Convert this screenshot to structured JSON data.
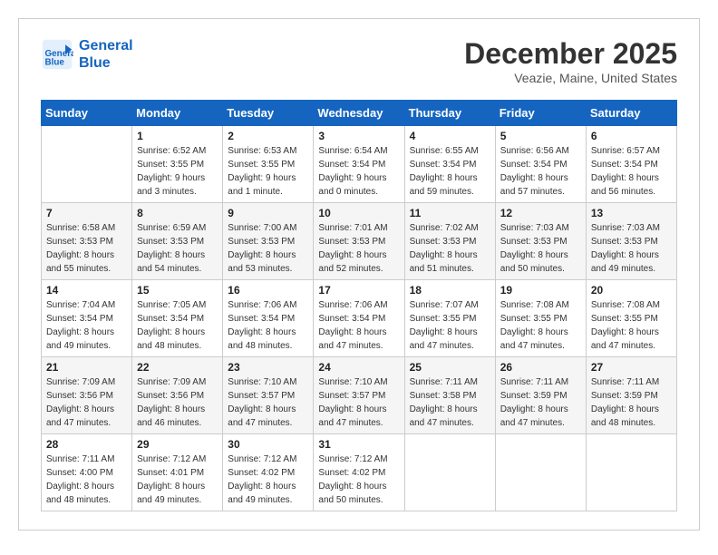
{
  "brand": {
    "line1": "General",
    "line2": "Blue"
  },
  "calendar": {
    "title": "December 2025",
    "subtitle": "Veazie, Maine, United States"
  },
  "headers": [
    "Sunday",
    "Monday",
    "Tuesday",
    "Wednesday",
    "Thursday",
    "Friday",
    "Saturday"
  ],
  "weeks": [
    [
      {
        "day": "",
        "sunrise": "",
        "sunset": "",
        "daylight": ""
      },
      {
        "day": "1",
        "sunrise": "Sunrise: 6:52 AM",
        "sunset": "Sunset: 3:55 PM",
        "daylight": "Daylight: 9 hours and 3 minutes."
      },
      {
        "day": "2",
        "sunrise": "Sunrise: 6:53 AM",
        "sunset": "Sunset: 3:55 PM",
        "daylight": "Daylight: 9 hours and 1 minute."
      },
      {
        "day": "3",
        "sunrise": "Sunrise: 6:54 AM",
        "sunset": "Sunset: 3:54 PM",
        "daylight": "Daylight: 9 hours and 0 minutes."
      },
      {
        "day": "4",
        "sunrise": "Sunrise: 6:55 AM",
        "sunset": "Sunset: 3:54 PM",
        "daylight": "Daylight: 8 hours and 59 minutes."
      },
      {
        "day": "5",
        "sunrise": "Sunrise: 6:56 AM",
        "sunset": "Sunset: 3:54 PM",
        "daylight": "Daylight: 8 hours and 57 minutes."
      },
      {
        "day": "6",
        "sunrise": "Sunrise: 6:57 AM",
        "sunset": "Sunset: 3:54 PM",
        "daylight": "Daylight: 8 hours and 56 minutes."
      }
    ],
    [
      {
        "day": "7",
        "sunrise": "Sunrise: 6:58 AM",
        "sunset": "Sunset: 3:53 PM",
        "daylight": "Daylight: 8 hours and 55 minutes."
      },
      {
        "day": "8",
        "sunrise": "Sunrise: 6:59 AM",
        "sunset": "Sunset: 3:53 PM",
        "daylight": "Daylight: 8 hours and 54 minutes."
      },
      {
        "day": "9",
        "sunrise": "Sunrise: 7:00 AM",
        "sunset": "Sunset: 3:53 PM",
        "daylight": "Daylight: 8 hours and 53 minutes."
      },
      {
        "day": "10",
        "sunrise": "Sunrise: 7:01 AM",
        "sunset": "Sunset: 3:53 PM",
        "daylight": "Daylight: 8 hours and 52 minutes."
      },
      {
        "day": "11",
        "sunrise": "Sunrise: 7:02 AM",
        "sunset": "Sunset: 3:53 PM",
        "daylight": "Daylight: 8 hours and 51 minutes."
      },
      {
        "day": "12",
        "sunrise": "Sunrise: 7:03 AM",
        "sunset": "Sunset: 3:53 PM",
        "daylight": "Daylight: 8 hours and 50 minutes."
      },
      {
        "day": "13",
        "sunrise": "Sunrise: 7:03 AM",
        "sunset": "Sunset: 3:53 PM",
        "daylight": "Daylight: 8 hours and 49 minutes."
      }
    ],
    [
      {
        "day": "14",
        "sunrise": "Sunrise: 7:04 AM",
        "sunset": "Sunset: 3:54 PM",
        "daylight": "Daylight: 8 hours and 49 minutes."
      },
      {
        "day": "15",
        "sunrise": "Sunrise: 7:05 AM",
        "sunset": "Sunset: 3:54 PM",
        "daylight": "Daylight: 8 hours and 48 minutes."
      },
      {
        "day": "16",
        "sunrise": "Sunrise: 7:06 AM",
        "sunset": "Sunset: 3:54 PM",
        "daylight": "Daylight: 8 hours and 48 minutes."
      },
      {
        "day": "17",
        "sunrise": "Sunrise: 7:06 AM",
        "sunset": "Sunset: 3:54 PM",
        "daylight": "Daylight: 8 hours and 47 minutes."
      },
      {
        "day": "18",
        "sunrise": "Sunrise: 7:07 AM",
        "sunset": "Sunset: 3:55 PM",
        "daylight": "Daylight: 8 hours and 47 minutes."
      },
      {
        "day": "19",
        "sunrise": "Sunrise: 7:08 AM",
        "sunset": "Sunset: 3:55 PM",
        "daylight": "Daylight: 8 hours and 47 minutes."
      },
      {
        "day": "20",
        "sunrise": "Sunrise: 7:08 AM",
        "sunset": "Sunset: 3:55 PM",
        "daylight": "Daylight: 8 hours and 47 minutes."
      }
    ],
    [
      {
        "day": "21",
        "sunrise": "Sunrise: 7:09 AM",
        "sunset": "Sunset: 3:56 PM",
        "daylight": "Daylight: 8 hours and 47 minutes."
      },
      {
        "day": "22",
        "sunrise": "Sunrise: 7:09 AM",
        "sunset": "Sunset: 3:56 PM",
        "daylight": "Daylight: 8 hours and 46 minutes."
      },
      {
        "day": "23",
        "sunrise": "Sunrise: 7:10 AM",
        "sunset": "Sunset: 3:57 PM",
        "daylight": "Daylight: 8 hours and 47 minutes."
      },
      {
        "day": "24",
        "sunrise": "Sunrise: 7:10 AM",
        "sunset": "Sunset: 3:57 PM",
        "daylight": "Daylight: 8 hours and 47 minutes."
      },
      {
        "day": "25",
        "sunrise": "Sunrise: 7:11 AM",
        "sunset": "Sunset: 3:58 PM",
        "daylight": "Daylight: 8 hours and 47 minutes."
      },
      {
        "day": "26",
        "sunrise": "Sunrise: 7:11 AM",
        "sunset": "Sunset: 3:59 PM",
        "daylight": "Daylight: 8 hours and 47 minutes."
      },
      {
        "day": "27",
        "sunrise": "Sunrise: 7:11 AM",
        "sunset": "Sunset: 3:59 PM",
        "daylight": "Daylight: 8 hours and 48 minutes."
      }
    ],
    [
      {
        "day": "28",
        "sunrise": "Sunrise: 7:11 AM",
        "sunset": "Sunset: 4:00 PM",
        "daylight": "Daylight: 8 hours and 48 minutes."
      },
      {
        "day": "29",
        "sunrise": "Sunrise: 7:12 AM",
        "sunset": "Sunset: 4:01 PM",
        "daylight": "Daylight: 8 hours and 49 minutes."
      },
      {
        "day": "30",
        "sunrise": "Sunrise: 7:12 AM",
        "sunset": "Sunset: 4:02 PM",
        "daylight": "Daylight: 8 hours and 49 minutes."
      },
      {
        "day": "31",
        "sunrise": "Sunrise: 7:12 AM",
        "sunset": "Sunset: 4:02 PM",
        "daylight": "Daylight: 8 hours and 50 minutes."
      },
      {
        "day": "",
        "sunrise": "",
        "sunset": "",
        "daylight": ""
      },
      {
        "day": "",
        "sunrise": "",
        "sunset": "",
        "daylight": ""
      },
      {
        "day": "",
        "sunrise": "",
        "sunset": "",
        "daylight": ""
      }
    ]
  ]
}
